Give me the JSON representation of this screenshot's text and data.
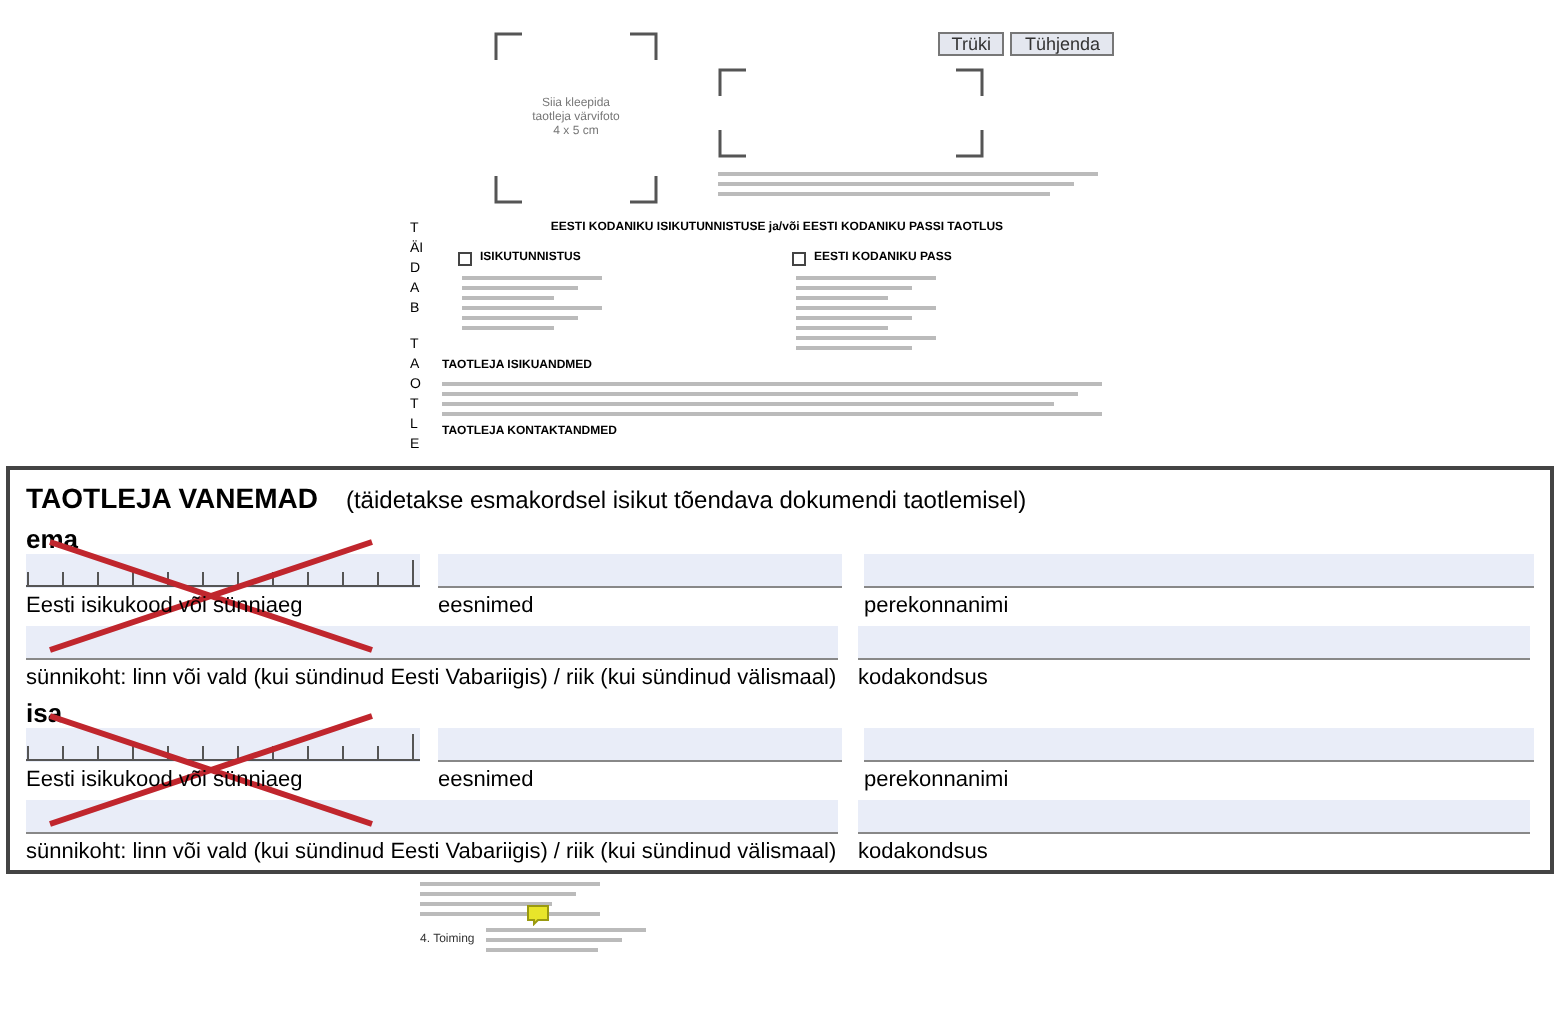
{
  "buttons": [
    {
      "label": "Trüki"
    },
    {
      "label": "Tühjenda"
    }
  ],
  "photo_box": {
    "text": "Siia kleepida taotleja värvifoto 4 x 5 cm"
  },
  "side_label": [
    "TÄIDAB",
    "TAOTLE"
  ],
  "form_title": "EESTI KODANIKU ISIKUTUNNISTUSE ja/või EESTI KODANIKU PASSI TAOTLUS",
  "document_types": [
    {
      "label": "ISIKUTUNNISTUS",
      "checked": false
    },
    {
      "label": "EESTI KODANIKU PASS",
      "checked": false
    }
  ],
  "subsections": [
    "TAOTLEJA ISIKUANDMED",
    "TAOTLEJA KONTAKTANDMED"
  ],
  "bottom_rows": [
    {
      "label": "4. Toiming"
    }
  ],
  "overlay": {
    "title": "TAOTLEJA VANEMAD",
    "subtitle": "(täidetakse esmakordsel isikut tõendava dokumendi taotlemisel)",
    "parents": [
      {
        "label": "ema",
        "crossed_out": true,
        "id_label": "Eesti isikukood või sünniaeg",
        "first_name_label": "eesnimed",
        "last_name_label": "perekonnanimi",
        "birthplace_label": "sünnikoht: linn või vald (kui sündinud Eesti Vabariigis) / riik (kui sündinud välismaal)",
        "citizenship_label": "kodakondsus"
      },
      {
        "label": "isa",
        "crossed_out": true,
        "id_label": "Eesti isikukood või sünniaeg",
        "first_name_label": "eesnimed",
        "last_name_label": "perekonnanimi",
        "birthplace_label": "sünnikoht: linn või vald (kui sündinud Eesti Vabariigis) / riik (kui sündinud välismaal)",
        "citizenship_label": "kodakondsus"
      }
    ]
  }
}
